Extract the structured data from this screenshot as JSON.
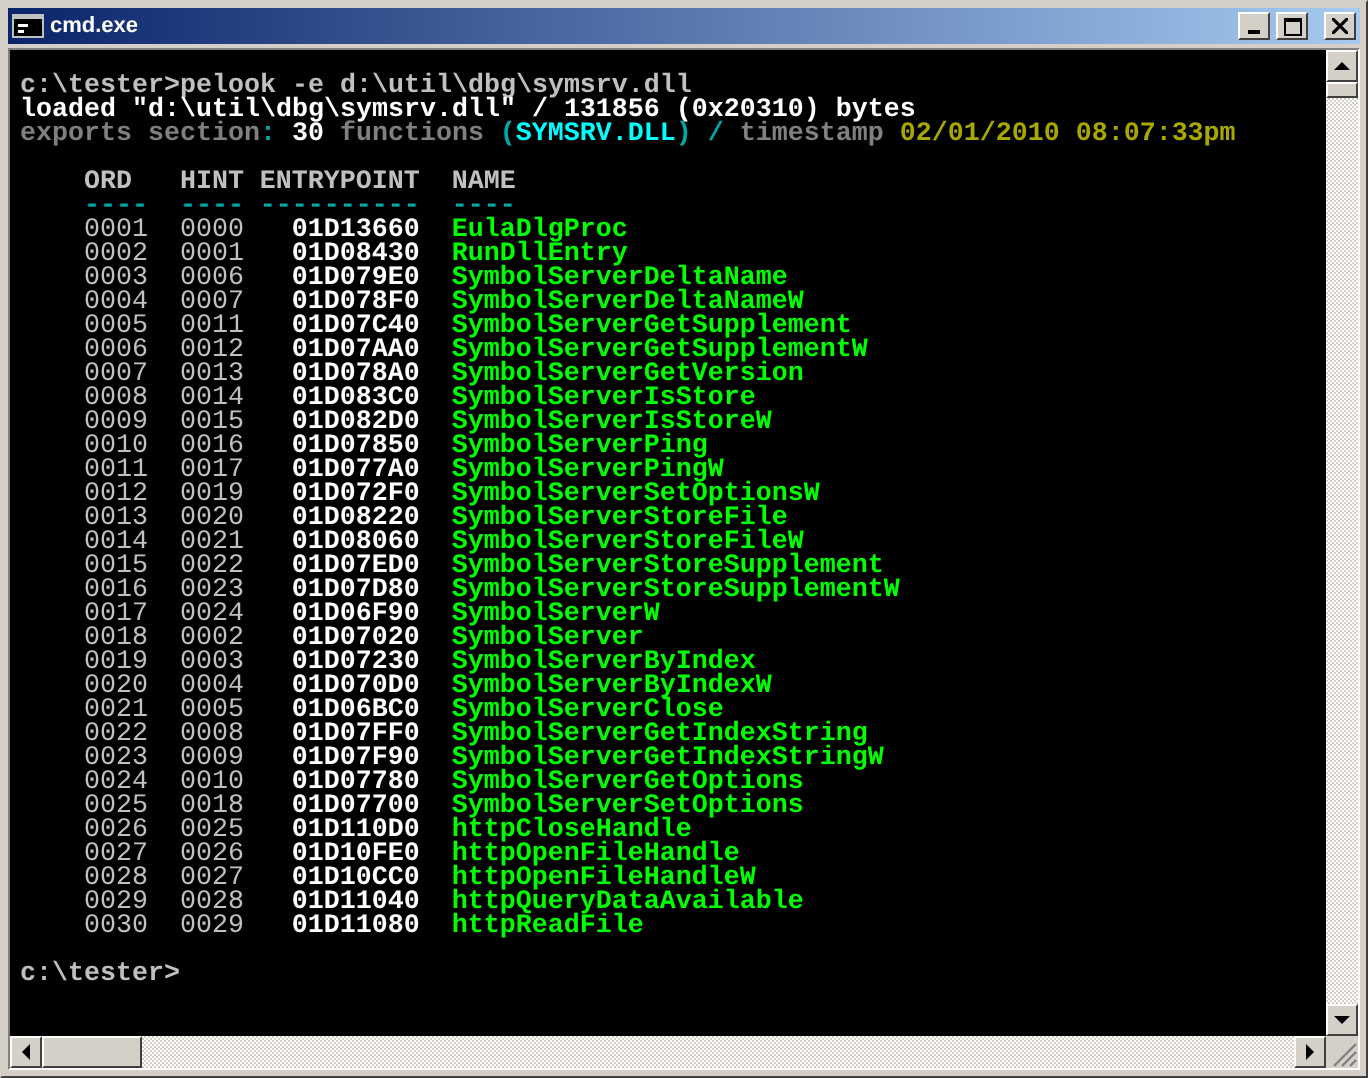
{
  "window": {
    "title": "cmd.exe"
  },
  "console": {
    "command_line": "c:\\tester>pelook -e d:\\util\\dbg\\symsrv.dll",
    "loaded_line": "loaded \"d:\\util\\dbg\\symsrv.dll\" / 131856 (0x20310) bytes",
    "exports_summary": [
      {
        "text": "exports section",
        "kind": "label",
        "space_before": false
      },
      {
        "text": ":",
        "kind": "punct",
        "space_before": false
      },
      {
        "text": "30",
        "kind": "value",
        "space_before": true
      },
      {
        "text": "functions",
        "kind": "label",
        "space_before": true
      },
      {
        "text": "(",
        "kind": "punct",
        "space_before": true
      },
      {
        "text": "SYMSRV.DLL",
        "kind": "module",
        "space_before": false
      },
      {
        "text": ")",
        "kind": "punct",
        "space_before": false
      },
      {
        "text": "/",
        "kind": "punct",
        "space_before": true
      },
      {
        "text": "timestamp",
        "kind": "label",
        "space_before": true
      },
      {
        "text": "02/01/2010 08:07:33pm",
        "kind": "date",
        "space_before": true
      }
    ],
    "table": {
      "columns": [
        {
          "header": "ORD",
          "rule": "----"
        },
        {
          "header": "HINT",
          "rule": "----"
        },
        {
          "header": "ENTRYPOINT",
          "rule": "----------"
        },
        {
          "header": "NAME",
          "rule": "----"
        }
      ],
      "rows": [
        {
          "ord": "0001",
          "hint": "0000",
          "entrypoint": "01D13660",
          "name": "EulaDlgProc"
        },
        {
          "ord": "0002",
          "hint": "0001",
          "entrypoint": "01D08430",
          "name": "RunDllEntry"
        },
        {
          "ord": "0003",
          "hint": "0006",
          "entrypoint": "01D079E0",
          "name": "SymbolServerDeltaName"
        },
        {
          "ord": "0004",
          "hint": "0007",
          "entrypoint": "01D078F0",
          "name": "SymbolServerDeltaNameW"
        },
        {
          "ord": "0005",
          "hint": "0011",
          "entrypoint": "01D07C40",
          "name": "SymbolServerGetSupplement"
        },
        {
          "ord": "0006",
          "hint": "0012",
          "entrypoint": "01D07AA0",
          "name": "SymbolServerGetSupplementW"
        },
        {
          "ord": "0007",
          "hint": "0013",
          "entrypoint": "01D078A0",
          "name": "SymbolServerGetVersion"
        },
        {
          "ord": "0008",
          "hint": "0014",
          "entrypoint": "01D083C0",
          "name": "SymbolServerIsStore"
        },
        {
          "ord": "0009",
          "hint": "0015",
          "entrypoint": "01D082D0",
          "name": "SymbolServerIsStoreW"
        },
        {
          "ord": "0010",
          "hint": "0016",
          "entrypoint": "01D07850",
          "name": "SymbolServerPing"
        },
        {
          "ord": "0011",
          "hint": "0017",
          "entrypoint": "01D077A0",
          "name": "SymbolServerPingW"
        },
        {
          "ord": "0012",
          "hint": "0019",
          "entrypoint": "01D072F0",
          "name": "SymbolServerSetOptionsW"
        },
        {
          "ord": "0013",
          "hint": "0020",
          "entrypoint": "01D08220",
          "name": "SymbolServerStoreFile"
        },
        {
          "ord": "0014",
          "hint": "0021",
          "entrypoint": "01D08060",
          "name": "SymbolServerStoreFileW"
        },
        {
          "ord": "0015",
          "hint": "0022",
          "entrypoint": "01D07ED0",
          "name": "SymbolServerStoreSupplement"
        },
        {
          "ord": "0016",
          "hint": "0023",
          "entrypoint": "01D07D80",
          "name": "SymbolServerStoreSupplementW"
        },
        {
          "ord": "0017",
          "hint": "0024",
          "entrypoint": "01D06F90",
          "name": "SymbolServerW"
        },
        {
          "ord": "0018",
          "hint": "0002",
          "entrypoint": "01D07020",
          "name": "SymbolServer"
        },
        {
          "ord": "0019",
          "hint": "0003",
          "entrypoint": "01D07230",
          "name": "SymbolServerByIndex"
        },
        {
          "ord": "0020",
          "hint": "0004",
          "entrypoint": "01D070D0",
          "name": "SymbolServerByIndexW"
        },
        {
          "ord": "0021",
          "hint": "0005",
          "entrypoint": "01D06BC0",
          "name": "SymbolServerClose"
        },
        {
          "ord": "0022",
          "hint": "0008",
          "entrypoint": "01D07FF0",
          "name": "SymbolServerGetIndexString"
        },
        {
          "ord": "0023",
          "hint": "0009",
          "entrypoint": "01D07F90",
          "name": "SymbolServerGetIndexStringW"
        },
        {
          "ord": "0024",
          "hint": "0010",
          "entrypoint": "01D07780",
          "name": "SymbolServerGetOptions"
        },
        {
          "ord": "0025",
          "hint": "0018",
          "entrypoint": "01D07700",
          "name": "SymbolServerSetOptions"
        },
        {
          "ord": "0026",
          "hint": "0025",
          "entrypoint": "01D110D0",
          "name": "httpCloseHandle"
        },
        {
          "ord": "0027",
          "hint": "0026",
          "entrypoint": "01D10FE0",
          "name": "httpOpenFileHandle"
        },
        {
          "ord": "0028",
          "hint": "0027",
          "entrypoint": "01D10CC0",
          "name": "httpOpenFileHandleW"
        },
        {
          "ord": "0029",
          "hint": "0028",
          "entrypoint": "01D11040",
          "name": "httpQueryDataAvailable"
        },
        {
          "ord": "0030",
          "hint": "0029",
          "entrypoint": "01D11080",
          "name": "httpReadFile"
        }
      ]
    },
    "prompt": "c:\\tester>"
  }
}
